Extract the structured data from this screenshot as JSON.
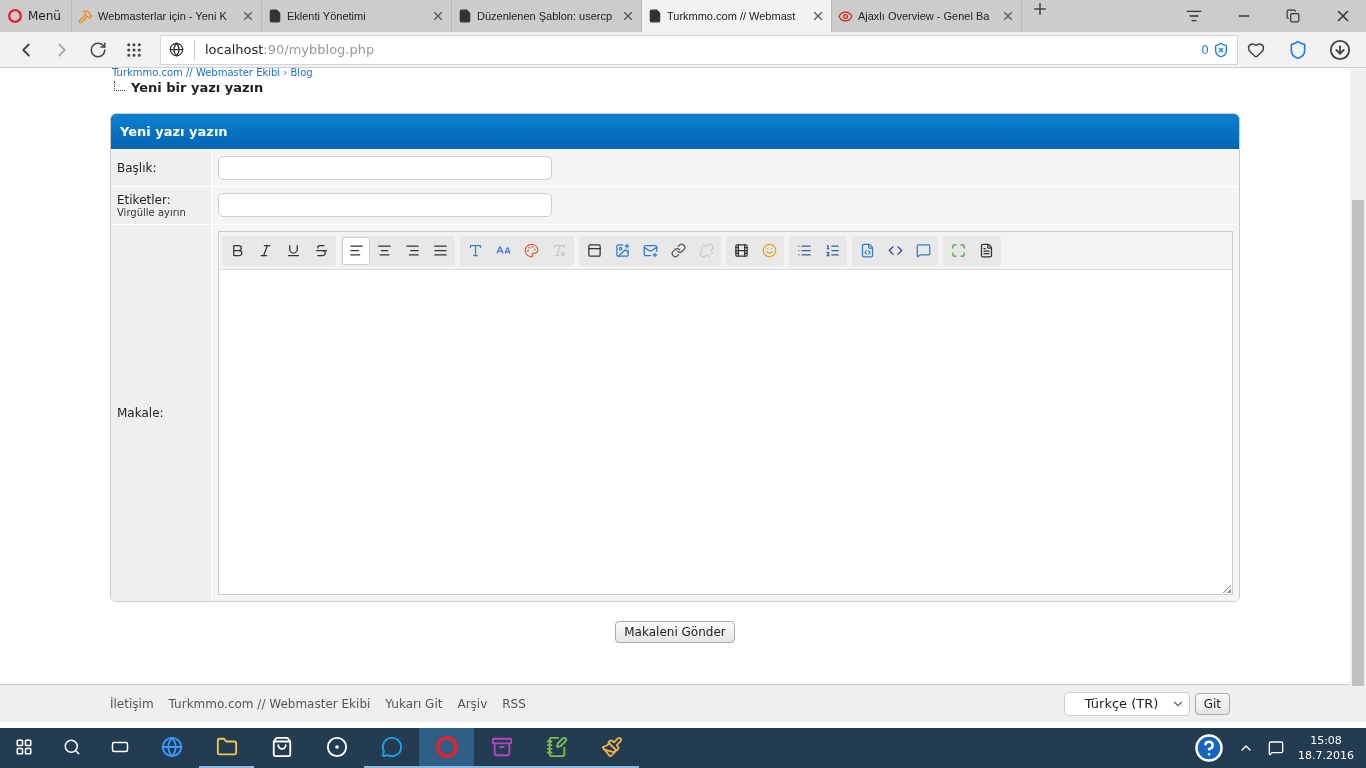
{
  "browser": {
    "menu": "Menü",
    "tabs": [
      {
        "title": "Webmasterlar için - Yeni K",
        "kind": "site",
        "selected": false
      },
      {
        "title": "Eklenti Yönetimi",
        "kind": "page",
        "selected": false
      },
      {
        "title": "Düzenlenen Şablon: usercp",
        "kind": "page",
        "selected": false
      },
      {
        "title": "Turkmmo.com // Webmast",
        "kind": "page",
        "selected": true
      },
      {
        "title": "Ajaxlı Overview - Genel Ba",
        "kind": "eye",
        "selected": false
      }
    ],
    "address": {
      "host": "localhost",
      "rest": ":90/mybblog.php"
    },
    "blocked_count": "0"
  },
  "breadcrumb": {
    "path": "Turkmmo.com // Webmaster Ekibi › Blog",
    "current": "Yeni bir yazı yazın"
  },
  "form": {
    "title": "Yeni yazı yazın",
    "fields": [
      {
        "label": "Başlık:",
        "kind": "input"
      },
      {
        "label": "Etiketler:",
        "hint": "Virgülle ayırın",
        "kind": "input"
      },
      {
        "label": "Makale:",
        "kind": "editor"
      }
    ],
    "toolbar": [
      {
        "buttons": [
          {
            "kind": "bold",
            "selected": false,
            "disabled": false
          },
          {
            "kind": "italic",
            "selected": false,
            "disabled": false
          },
          {
            "kind": "underline",
            "selected": false,
            "disabled": false
          },
          {
            "kind": "strike",
            "selected": false,
            "disabled": false
          }
        ]
      },
      {
        "buttons": [
          {
            "kind": "align-left",
            "selected": true,
            "disabled": false
          },
          {
            "kind": "align-center",
            "selected": false,
            "disabled": false
          },
          {
            "kind": "align-right",
            "selected": false,
            "disabled": false
          },
          {
            "kind": "justify",
            "selected": false,
            "disabled": false
          }
        ]
      },
      {
        "buttons": [
          {
            "kind": "font",
            "selected": false,
            "disabled": false
          },
          {
            "kind": "size",
            "selected": false,
            "disabled": false
          },
          {
            "kind": "color",
            "selected": false,
            "disabled": false
          },
          {
            "kind": "remove-format",
            "selected": false,
            "disabled": true
          }
        ]
      },
      {
        "buttons": [
          {
            "kind": "rule",
            "selected": false,
            "disabled": false
          },
          {
            "kind": "image",
            "selected": false,
            "disabled": false
          },
          {
            "kind": "email",
            "selected": false,
            "disabled": false
          },
          {
            "kind": "link",
            "selected": false,
            "disabled": false
          },
          {
            "kind": "unlink",
            "selected": false,
            "disabled": true
          }
        ]
      },
      {
        "buttons": [
          {
            "kind": "video",
            "selected": false,
            "disabled": false
          },
          {
            "kind": "emoticon",
            "selected": false,
            "disabled": false
          }
        ]
      },
      {
        "buttons": [
          {
            "kind": "bullets",
            "selected": false,
            "disabled": false
          },
          {
            "kind": "numbers",
            "selected": false,
            "disabled": false
          }
        ]
      },
      {
        "buttons": [
          {
            "kind": "code",
            "selected": false,
            "disabled": false
          },
          {
            "kind": "php",
            "selected": false,
            "disabled": false
          },
          {
            "kind": "quote",
            "selected": false,
            "disabled": false
          }
        ]
      },
      {
        "buttons": [
          {
            "kind": "maximize",
            "selected": false,
            "disabled": false
          },
          {
            "kind": "source",
            "selected": false,
            "disabled": false
          }
        ]
      }
    ],
    "submit": "Makaleni Gönder"
  },
  "footer": {
    "links": [
      "İletişim",
      "Turkmmo.com // Webmaster Ekibi",
      "Yukarı Git",
      "Arşiv",
      "RSS"
    ],
    "language": "Türkçe (TR)",
    "go": "Git"
  },
  "taskbar": {
    "apps": [
      {
        "kind": "edge",
        "running": false,
        "selected": false
      },
      {
        "kind": "folder",
        "running": true,
        "selected": false
      },
      {
        "kind": "store",
        "running": false,
        "selected": false
      },
      {
        "kind": "hp",
        "running": false,
        "selected": false
      },
      {
        "kind": "skype",
        "running": true,
        "selected": false
      },
      {
        "kind": "opera",
        "running": true,
        "selected": true
      },
      {
        "kind": "archive",
        "running": true,
        "selected": false
      },
      {
        "kind": "notepad",
        "running": true,
        "selected": false
      },
      {
        "kind": "paint",
        "running": true,
        "selected": false
      }
    ],
    "time": "15:08",
    "date": "18.7.2016"
  }
}
